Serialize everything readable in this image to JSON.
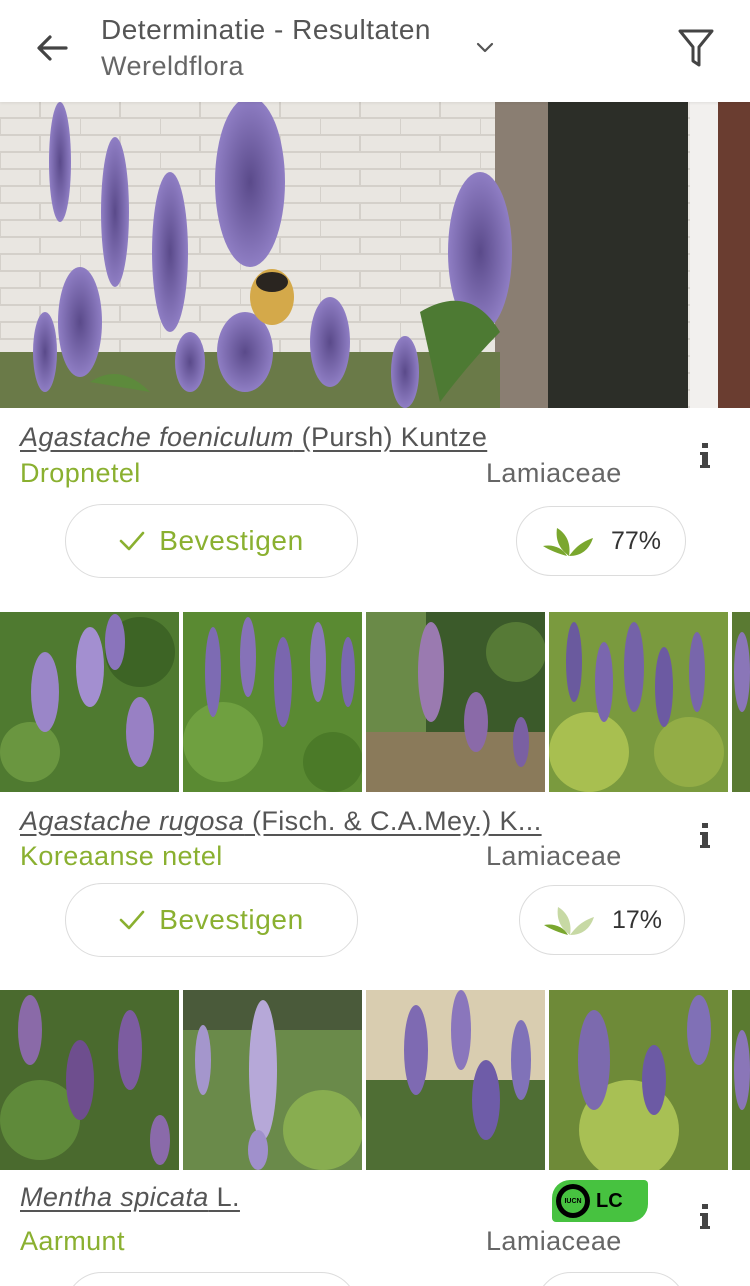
{
  "header": {
    "title": "Determinatie - Resultaten",
    "subtitle": "Wereldflora"
  },
  "results": [
    {
      "scientific_genus_species": "Agastache foeniculum",
      "scientific_author": " (Pursh) Kuntze",
      "common_name": "Dropnetel",
      "family": "Lamiaceae",
      "confirm_label": "Bevestigen",
      "score": "77%"
    },
    {
      "scientific_genus_species": "Agastache rugosa",
      "scientific_author": " (Fisch. & C.A.Mey.) K...",
      "common_name": "Koreaanse netel",
      "family": "Lamiaceae",
      "confirm_label": "Bevestigen",
      "score": "17%"
    },
    {
      "scientific_genus_species": "Mentha spicata",
      "scientific_author": " L.",
      "common_name": "Aarmunt",
      "family": "Lamiaceae",
      "iucn_label": "IUCN",
      "iucn_status": "LC"
    }
  ],
  "colors": {
    "accent_green": "#8ab030",
    "iucn_green": "#47c240",
    "text_gray": "#555555"
  },
  "icons": [
    "back-arrow-icon",
    "chevron-down-icon",
    "filter-icon",
    "info-icon",
    "checkmark-icon",
    "leaf-score-icon"
  ]
}
